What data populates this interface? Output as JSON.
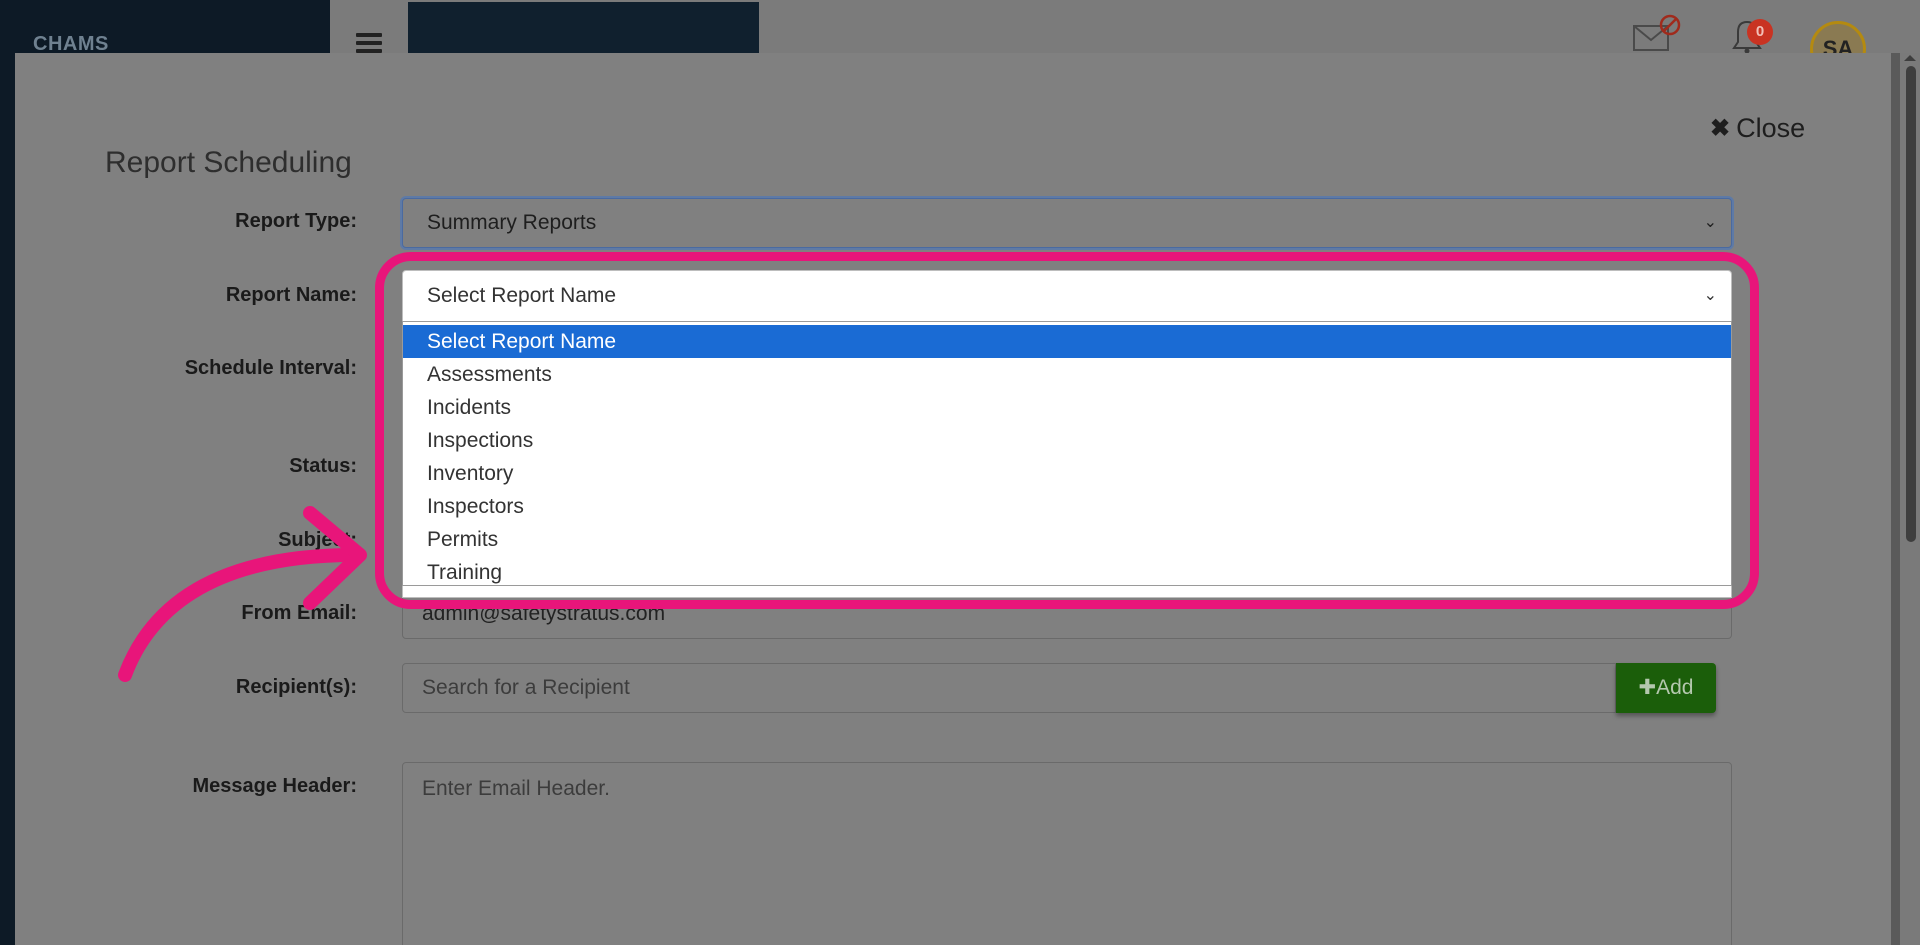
{
  "app": {
    "logo": "CHAMS",
    "notification_count": "0",
    "avatar_initials": "SA"
  },
  "modal": {
    "title": "Report Scheduling",
    "close_label": "Close"
  },
  "form": {
    "report_type_label": "Report Type:",
    "report_type_value": "Summary Reports",
    "report_name_label": "Report Name:",
    "report_name_value": "Select Report Name",
    "schedule_interval_label": "Schedule Interval:",
    "status_label": "Status:",
    "subject_label": "Subject:",
    "from_email_label": "From Email:",
    "from_email_value": "admin@safetystratus.com",
    "recipients_label": "Recipient(s):",
    "recipients_placeholder": "Search for a Recipient",
    "add_label": "Add",
    "message_header_label": "Message Header:",
    "message_header_placeholder": "Enter Email Header."
  },
  "dropdown": {
    "options": [
      "Select Report Name",
      "Assessments",
      "Incidents",
      "Inspections",
      "Inventory",
      "Inspectors",
      "Permits",
      "Training"
    ],
    "selected_index": 0
  },
  "colors": {
    "highlight": "#e8157a",
    "selected_option": "#1a6bd4",
    "add_button": "#1b5e0a"
  }
}
